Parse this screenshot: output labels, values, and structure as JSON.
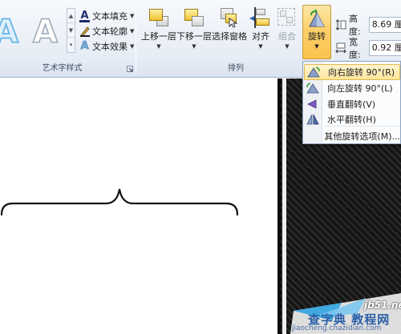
{
  "ribbon": {
    "wordart_group": {
      "label": "艺术字样式",
      "text_fill": "文本填充",
      "text_outline": "文本轮廓",
      "text_effects": "文本效果",
      "art_letter": "A"
    },
    "arrange_group": {
      "label": "排列",
      "bring_forward": "上移一层",
      "send_backward": "下移一层",
      "selection_pane": "选择窗格",
      "align": "对齐",
      "group": "组合",
      "rotate": "旋转"
    },
    "size_group": {
      "height_label": "高度:",
      "height_value": "8.69 厘",
      "width_label": "宽度:",
      "width_value": "0.92 厘"
    }
  },
  "rotate_menu": {
    "items": [
      {
        "label": "向右旋转 90°(R)",
        "icon": "rotate-right-icon",
        "highlighted": true
      },
      {
        "label": "向左旋转 90°(L)",
        "icon": "rotate-left-icon",
        "highlighted": false
      },
      {
        "label": "垂直翻转(V)",
        "icon": "flip-vertical-icon",
        "highlighted": false
      },
      {
        "label": "水平翻转(H)",
        "icon": "flip-horizontal-icon",
        "highlighted": false
      },
      {
        "label": "其他旋转选项(M)...",
        "icon": "",
        "highlighted": false
      }
    ]
  },
  "watermark": {
    "site": "jb51.net",
    "name": "查字典 教程网",
    "url": "jiaocheng.chazidian.com"
  },
  "colors": {
    "accent_yellow": "#fbc24e",
    "menu_highlight": "#fde59c",
    "ribbon_bg": "#e6ecf5",
    "photo_dark": "#1c1c1c"
  }
}
